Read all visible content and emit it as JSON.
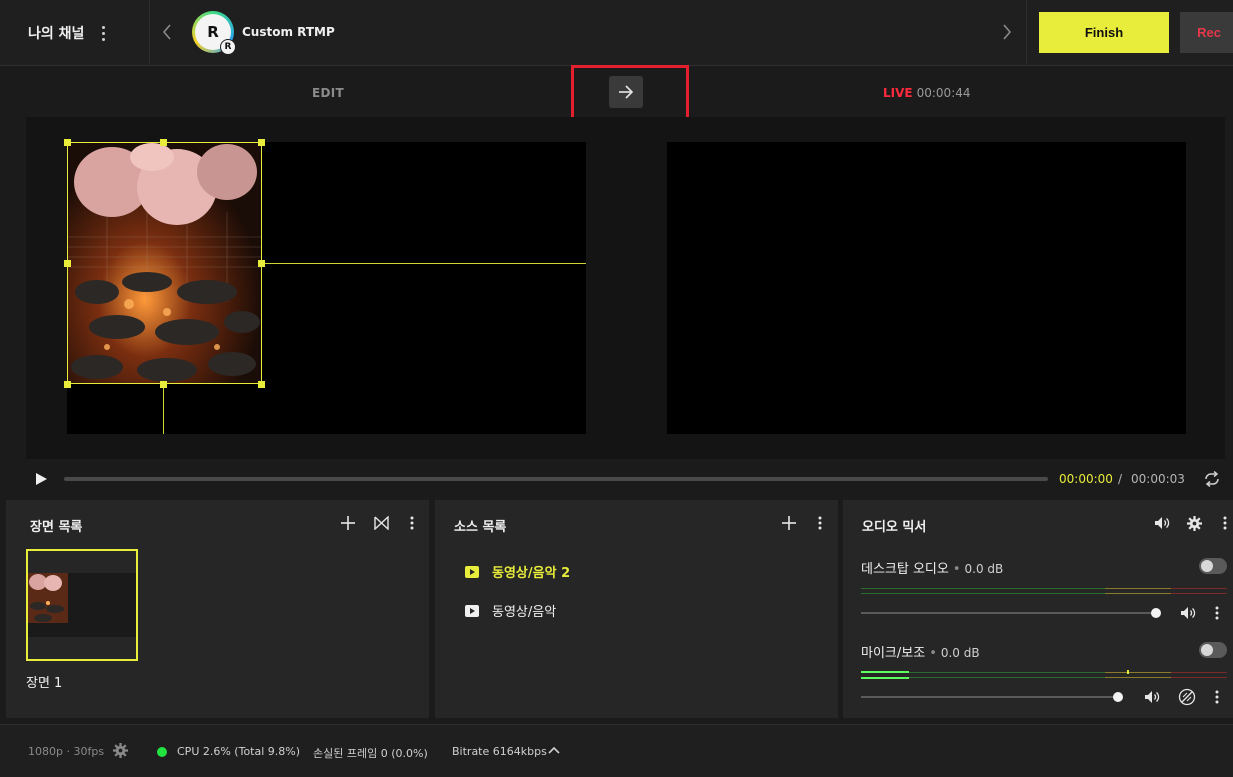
{
  "header": {
    "channel_name": "나의 채널",
    "platform_name": "Custom RTMP",
    "platform_logo_letter": "R",
    "platform_logo_badge": "R",
    "finish_label": "Finish",
    "rec_label": "Rec"
  },
  "mode": {
    "edit_label": "EDIT",
    "live_label": "LIVE",
    "live_time": "00:00:44"
  },
  "playback": {
    "current_time": "00:00:00",
    "separator": "/",
    "total_time": "00:00:03"
  },
  "scenes": {
    "title": "장면 목록",
    "items": [
      {
        "label": "장면 1",
        "selected": true
      }
    ]
  },
  "sources": {
    "title": "소스 목록",
    "items": [
      {
        "label": "동영상/음악 2",
        "selected": true
      },
      {
        "label": "동영상/음악",
        "selected": false
      }
    ]
  },
  "mixer": {
    "title": "오디오 믹서",
    "channels": [
      {
        "label": "데스크탑 오디오",
        "db": "0.0 dB",
        "volume_percent": 100
      },
      {
        "label": "마이크/보조",
        "db": "0.0 dB",
        "volume_percent": 87
      }
    ]
  },
  "status": {
    "resolution": "1080p · 30fps",
    "cpu": "CPU 2.6% (Total 9.8%)",
    "dropped_frames": "손실된 프레임 0 (0.0%)",
    "bitrate": "Bitrate 6164kbps"
  },
  "colors": {
    "accent_yellow": "#e8ec3a",
    "live_red": "#ff2a3d",
    "rec_red": "#e5384a",
    "cpu_ok_green": "#22e33f",
    "highlight_box_red": "#e5202e"
  },
  "icons": [
    "more-vertical-icon",
    "chevron-left-icon",
    "chevron-right-icon",
    "arrow-right-icon",
    "play-icon",
    "loop-icon",
    "plus-icon",
    "transition-icon",
    "speaker-icon",
    "gear-icon",
    "mute-icon",
    "chevron-up-icon"
  ]
}
